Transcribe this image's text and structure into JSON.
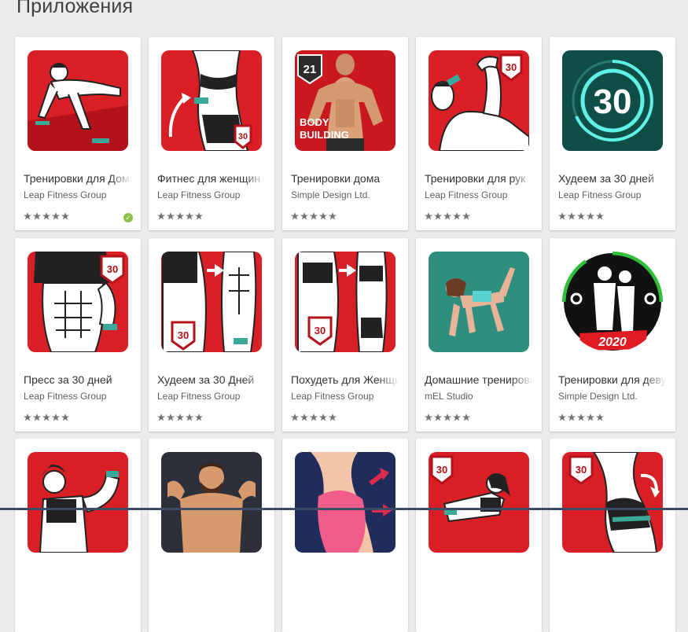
{
  "section": {
    "title": "Приложения"
  },
  "apps": [
    {
      "title": "Тренировки для Дома",
      "developer": "Leap Fitness Group",
      "rating": 4.5,
      "verified": true,
      "icon": "pushup-man-icon"
    },
    {
      "title": "Фитнес для женщин",
      "developer": "Leap Fitness Group",
      "rating": 4.5,
      "verified": false,
      "icon": "woman-waist-icon"
    },
    {
      "title": "Тренировки дома",
      "developer": "Simple Design Ltd.",
      "rating": 4.5,
      "verified": false,
      "icon": "bodybuilding-21-icon"
    },
    {
      "title": "Тренировки для рук",
      "developer": "Leap Fitness Group",
      "rating": 4.5,
      "verified": false,
      "icon": "arm-flex-icon"
    },
    {
      "title": "Худеем за 30 дней",
      "developer": "Leap Fitness Group",
      "rating": 4.5,
      "verified": false,
      "icon": "thirty-days-circle-icon"
    },
    {
      "title": "Пресс за 30 дней",
      "developer": "Leap Fitness Group",
      "rating": 4.5,
      "verified": false,
      "icon": "abs-man-icon"
    },
    {
      "title": "Худеем за 30 Дней",
      "developer": "Leap Fitness Group",
      "rating": 4.5,
      "verified": false,
      "icon": "man-before-after-icon"
    },
    {
      "title": "Похудеть для Женщин",
      "developer": "Leap Fitness Group",
      "rating": 4.5,
      "verified": false,
      "icon": "woman-before-after-icon"
    },
    {
      "title": "Домашние тренировки",
      "developer": "mEL Studio",
      "rating": 4.5,
      "verified": false,
      "icon": "woman-kneeling-icon"
    },
    {
      "title": "Тренировки для девушек",
      "developer": "Simple Design Ltd.",
      "rating": 4.5,
      "verified": false,
      "icon": "couple-2020-icon"
    },
    {
      "title": "",
      "developer": "",
      "rating": 0,
      "verified": false,
      "icon": "woman-flex-icon"
    },
    {
      "title": "",
      "developer": "",
      "rating": 0,
      "verified": false,
      "icon": "bodybuilder-cartoon-icon"
    },
    {
      "title": "",
      "developer": "",
      "rating": 0,
      "verified": false,
      "icon": "glutes-pink-icon"
    },
    {
      "title": "",
      "developer": "",
      "rating": 0,
      "verified": false,
      "icon": "woman-stretch-icon"
    },
    {
      "title": "",
      "developer": "",
      "rating": 0,
      "verified": false,
      "icon": "glutes-30-icon"
    }
  ],
  "icon_badges": {
    "thirty": "30",
    "twentyone": "21",
    "year": "2020",
    "bodybuilding_line1": "BODY",
    "bodybuilding_line2": "BUILDING"
  },
  "colors": {
    "red": "#e01b24",
    "dark_red": "#b3121a",
    "teal_dark": "#0f4e47",
    "teal_ring": "#5ff0e6",
    "green": "#2fbf3a",
    "star": "#757575",
    "check": "#8bc34a"
  }
}
